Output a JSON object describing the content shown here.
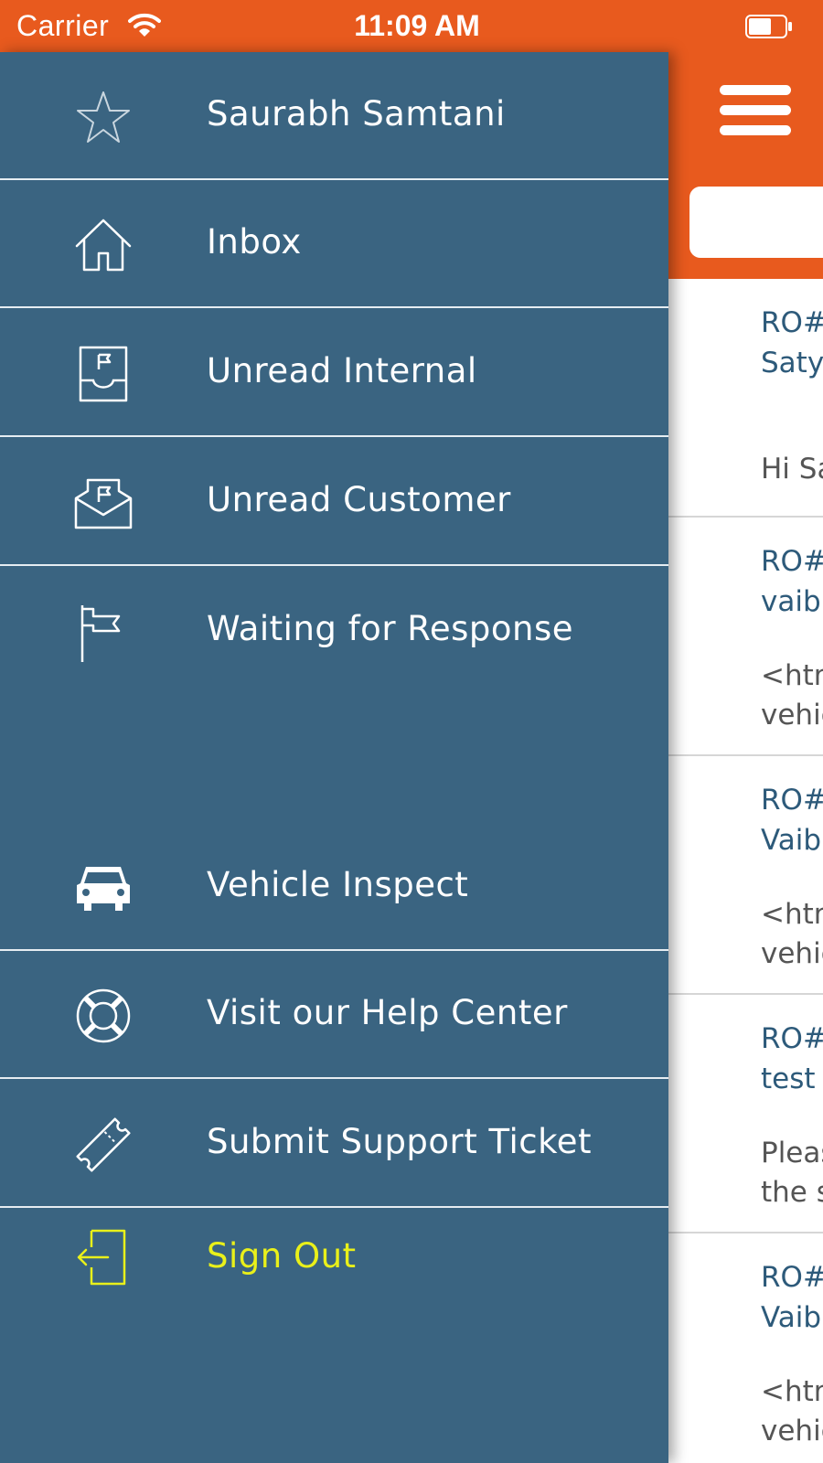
{
  "status_bar": {
    "carrier": "Carrier",
    "time": "11:09 AM",
    "accent_color": "#e85a1e"
  },
  "drawer": {
    "background_color": "#3a6481",
    "items": [
      {
        "label": "Saurabh Samtani",
        "icon": "star-icon"
      },
      {
        "label": "Inbox",
        "icon": "home-icon"
      },
      {
        "label": "Unread Internal",
        "icon": "inbox-tray-flag-icon"
      },
      {
        "label": "Unread Customer",
        "icon": "envelope-flag-icon"
      },
      {
        "label": "Waiting for Response",
        "icon": "flag-icon"
      },
      {
        "label": "Vehicle Inspect",
        "icon": "car-icon"
      },
      {
        "label": "Visit our Help Center",
        "icon": "lifebuoy-icon"
      },
      {
        "label": "Submit Support Ticket",
        "icon": "ticket-icon"
      },
      {
        "label": "Sign Out",
        "icon": "sign-out-icon",
        "color": "#e9f01a"
      }
    ]
  },
  "messages": [
    {
      "ro": "RO#",
      "who": "Saty",
      "body1": "Hi Sa",
      "body2": ""
    },
    {
      "ro": "RO#",
      "who": "vaibl",
      "body1": "<htm",
      "body2": "vehic"
    },
    {
      "ro": "RO#",
      "who": "Vaib",
      "body1": "<htm",
      "body2": "vehic"
    },
    {
      "ro": "RO#",
      "who": "test",
      "body1": "Pleas",
      "body2": "the s"
    },
    {
      "ro": "RO#",
      "who": "Vaib",
      "body1": "<htm",
      "body2": "vehic"
    }
  ]
}
